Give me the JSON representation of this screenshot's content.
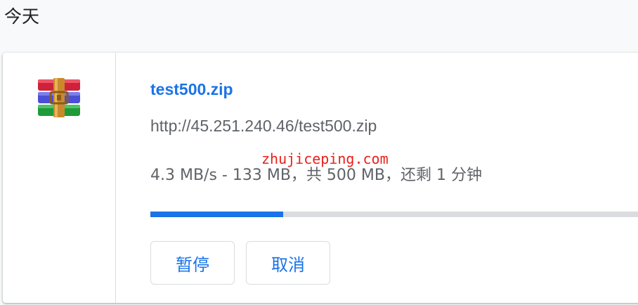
{
  "section": {
    "title": "今天"
  },
  "download": {
    "file_name": "test500.zip",
    "url": "http://45.251.240.46/test500.zip",
    "status": "4.3 MB/s - 133 MB，共 500 MB，还剩 1 分钟",
    "progress_fraction": 0.266,
    "icon": "winrar-archive-icon",
    "actions": {
      "pause_label": "暂停",
      "cancel_label": "取消"
    }
  },
  "watermark": "zhujiceping.com",
  "colors": {
    "accent": "#1a73e8",
    "progress_track": "#dadce0",
    "text_secondary": "#5f6368",
    "watermark": "#e8201a"
  }
}
